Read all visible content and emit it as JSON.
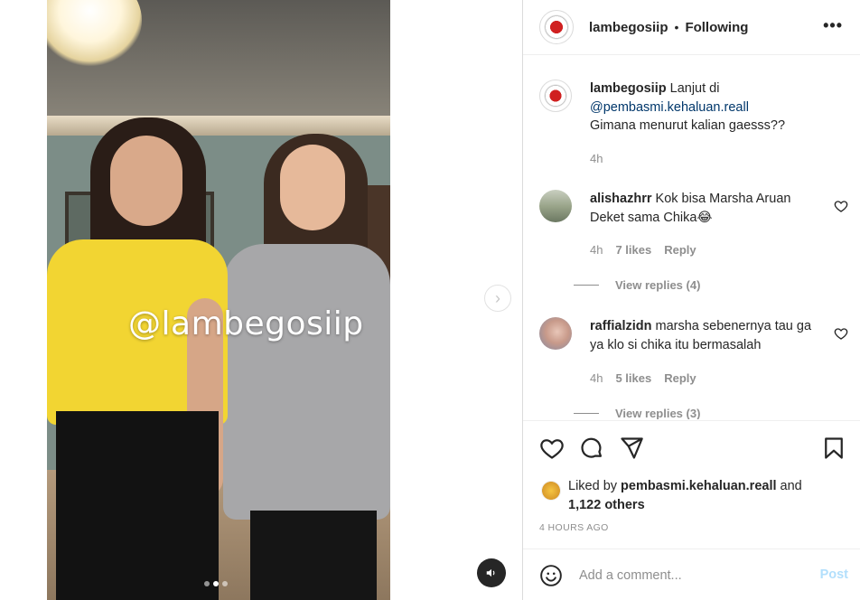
{
  "media": {
    "watermark": "@lambegosiip",
    "carousel_dots": 3,
    "active_dot": 1
  },
  "header": {
    "username": "lambegosiip",
    "separator": "•",
    "follow_status": "Following",
    "more_icon": "more-horizontal-icon"
  },
  "caption": {
    "username": "lambegosiip",
    "text_before": "Lanjut di",
    "mention": "@pembasmi.kehaluan.reall",
    "line2": "Gimana menurut kalian gaesss??",
    "time": "4h"
  },
  "comments": [
    {
      "username": "alishazhrr",
      "text": "Kok bisa Marsha Aruan Deket sama Chika😂",
      "time": "4h",
      "likes": "7 likes",
      "reply_label": "Reply",
      "view_replies": "View replies (4)"
    },
    {
      "username": "raffialzidn",
      "text": "marsha sebenernya tau ga ya klo si chika itu bermasalah",
      "time": "4h",
      "likes": "5 likes",
      "reply_label": "Reply",
      "view_replies": "View replies (3)"
    }
  ],
  "actions": {
    "like_icon": "heart-icon",
    "comment_icon": "comment-icon",
    "share_icon": "share-icon",
    "save_icon": "bookmark-icon"
  },
  "likes": {
    "prefix": "Liked by",
    "user": "pembasmi.kehaluan.reall",
    "conj": "and",
    "others": "1,122 others"
  },
  "timestamp": "4 HOURS AGO",
  "add_comment": {
    "placeholder": "Add a comment...",
    "post_label": "Post"
  },
  "colors": {
    "link": "#00376b",
    "muted": "#8e8e8e",
    "post_disabled": "#b2dffc"
  }
}
